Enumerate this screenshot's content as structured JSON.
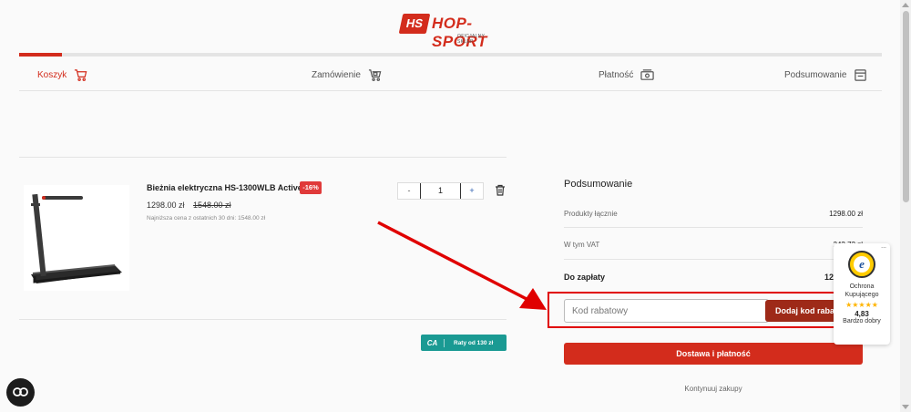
{
  "header": {
    "logo_mark": "HS",
    "logo_text": "HOP-SPORT",
    "logo_subtitle": "OFICJALNY SKLEP"
  },
  "progress": {
    "completed_fraction": 0.05
  },
  "steps": [
    {
      "label": "Koszyk",
      "icon": "cart-icon",
      "active": true
    },
    {
      "label": "Zamówienie",
      "icon": "delivery-cart-icon",
      "active": false
    },
    {
      "label": "Płatność",
      "icon": "payment-icon",
      "active": false
    },
    {
      "label": "Podsumowanie",
      "icon": "summary-icon",
      "active": false
    }
  ],
  "product": {
    "name": "Bieżnia elektryczna HS-1300WLB Active",
    "discount_badge": "-16%",
    "price": "1298.00 zł",
    "old_price": "1548.00 zł",
    "price_note": "Najniższa cena z ostatnich 30 dni: 1548.00 zł",
    "quantity": "1",
    "minus_label": "-",
    "plus_label": "+"
  },
  "installments": {
    "logo": "CA",
    "label": "Raty od 130 zł"
  },
  "summary": {
    "title": "Podsumowanie",
    "products_total_label": "Produkty łącznie",
    "products_total_value": "1298.00 zł",
    "vat_label": "W tym VAT",
    "vat_value": "242.72 zł",
    "to_pay_label": "Do zapłaty",
    "to_pay_value": "1298.00 zł",
    "coupon_placeholder": "Kod rabatowy",
    "coupon_button": "Dodaj kod rabatowy",
    "checkout_button": "Dostawa i płatność",
    "continue_link": "Kontynuuj zakupy"
  },
  "trusted_badge": {
    "menu": "...",
    "seal_letter": "e",
    "label_line1": "Ochrona",
    "label_line2": "Kupującego",
    "stars": "★★★★★",
    "rating": "4,83",
    "rating_text": "Bardzo dobry"
  },
  "colors": {
    "brand": "#d32c1c",
    "coupon_button": "#9e2a18",
    "installments": "#1a9a93",
    "annotation": "#e00000"
  }
}
